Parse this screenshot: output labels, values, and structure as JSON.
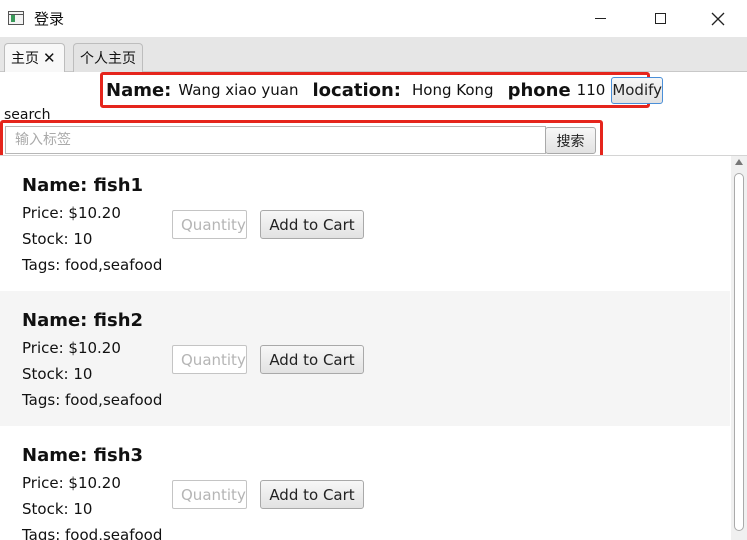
{
  "window": {
    "title": "登录",
    "icon": "app-window-icon"
  },
  "tabs": [
    {
      "label": "主页",
      "close": "✕",
      "selected": true
    },
    {
      "label": "个人主页",
      "selected": false
    }
  ],
  "user_info": {
    "name_label": "Name:",
    "name_value": "Wang xiao yuan",
    "location_label": "location:",
    "location_value": "Hong Kong",
    "phone_label": "phone",
    "phone_value": "110",
    "modify_button": "Modify"
  },
  "search": {
    "label": "search",
    "placeholder": "输入标签",
    "button": "搜索"
  },
  "products": [
    {
      "name": "Name: fish1",
      "price": "Price: $10.20",
      "stock": "Stock: 10",
      "tags": "Tags: food,seafood",
      "quantity_placeholder": "Quantity",
      "add_button": "Add to Cart"
    },
    {
      "name": "Name: fish2",
      "price": "Price: $10.20",
      "stock": "Stock: 10",
      "tags": "Tags: food,seafood",
      "quantity_placeholder": "Quantity",
      "add_button": "Add to Cart"
    },
    {
      "name": "Name: fish3",
      "price": "Price: $10.20",
      "stock": "Stock: 10",
      "tags": "Tags: food,seafood",
      "quantity_placeholder": "Quantity",
      "add_button": "Add to Cart"
    }
  ],
  "colors": {
    "highlight_border": "#e5251c",
    "focus_border": "#4a8fd8"
  }
}
